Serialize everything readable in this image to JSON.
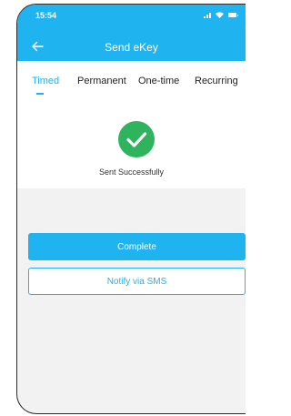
{
  "status_bar": {
    "time": "15:54"
  },
  "header": {
    "title": "Send eKey",
    "back_icon": "arrow-left-icon"
  },
  "tabs": [
    {
      "label": "Timed",
      "active": true
    },
    {
      "label": "Permanent",
      "active": false
    },
    {
      "label": "One-time",
      "active": false
    },
    {
      "label": "Recurring",
      "active": false
    }
  ],
  "result": {
    "icon": "check-circle-icon",
    "message": "Sent Successfully"
  },
  "actions": {
    "complete_label": "Complete",
    "sms_label": "Notify via SMS"
  },
  "colors": {
    "accent": "#1fb3f0",
    "success": "#2fb45e",
    "background": "#f2f2f2"
  }
}
